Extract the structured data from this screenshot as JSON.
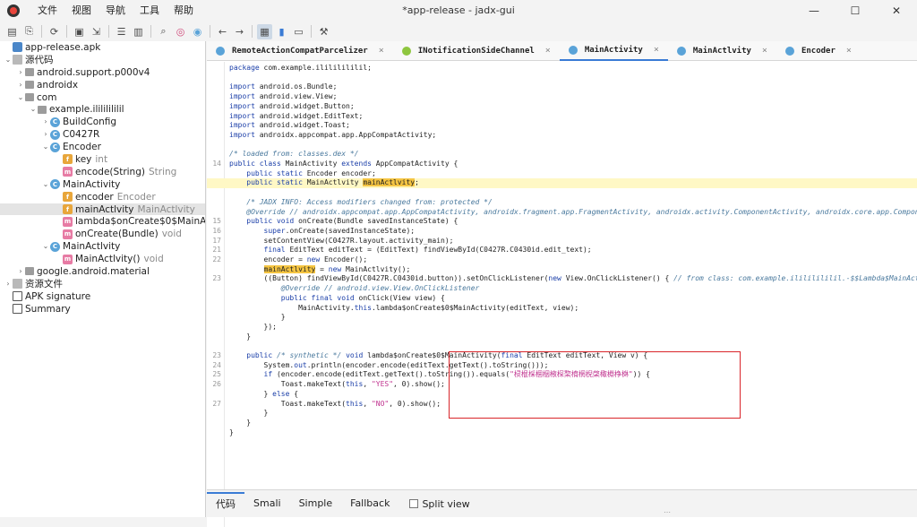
{
  "window": {
    "title": "*app-release - jadx-gui",
    "controls": [
      "—",
      "☐",
      "✕"
    ]
  },
  "menu": [
    "文件",
    "视图",
    "导航",
    "工具",
    "帮助"
  ],
  "toolbar": {
    "icons": [
      "open-icon",
      "save-all-icon",
      "sync-icon",
      "save-icon",
      "export-icon",
      "flatten-icon",
      "deobf-icon",
      "search-icon",
      "search-class-icon",
      "search-usage-icon",
      "back-icon",
      "forward-icon",
      "quark-icon",
      "log-icon",
      "settings-icon"
    ]
  },
  "tree": [
    {
      "label": "app-release.apk",
      "type": "",
      "indent": 0,
      "tw": "",
      "icon": "apk"
    },
    {
      "label": "源代码",
      "type": "",
      "indent": 0,
      "tw": "⌄",
      "icon": "src"
    },
    {
      "label": "android.support.p000v4",
      "type": "",
      "indent": 1,
      "tw": "›",
      "icon": "pkg"
    },
    {
      "label": "androidx",
      "type": "",
      "indent": 1,
      "tw": "›",
      "icon": "pkg"
    },
    {
      "label": "com",
      "type": "",
      "indent": 1,
      "tw": "⌄",
      "icon": "pkg"
    },
    {
      "label": "example.ilililililil",
      "type": "",
      "indent": 2,
      "tw": "⌄",
      "icon": "pkg"
    },
    {
      "label": "BuildConfig",
      "type": "",
      "indent": 3,
      "tw": "›",
      "icon": "c"
    },
    {
      "label": "C0427R",
      "type": "",
      "indent": 3,
      "tw": "›",
      "icon": "c"
    },
    {
      "label": "Encoder",
      "type": "",
      "indent": 3,
      "tw": "⌄",
      "icon": "c"
    },
    {
      "label": "key",
      "type": "int",
      "indent": 4,
      "tw": "",
      "icon": "f"
    },
    {
      "label": "encode(String)",
      "type": "String",
      "indent": 4,
      "tw": "",
      "icon": "m"
    },
    {
      "label": "MainActivity",
      "type": "",
      "indent": 3,
      "tw": "⌄",
      "icon": "c"
    },
    {
      "label": "encoder",
      "type": "Encoder",
      "indent": 4,
      "tw": "",
      "icon": "f"
    },
    {
      "label": "mainActlvity",
      "type": "MainActlvity",
      "indent": 4,
      "tw": "",
      "icon": "f",
      "selected": true
    },
    {
      "label": "lambda$onCreate$0$MainActi",
      "type": "",
      "indent": 4,
      "tw": "",
      "icon": "m"
    },
    {
      "label": "onCreate(Bundle)",
      "type": "void",
      "indent": 4,
      "tw": "",
      "icon": "m"
    },
    {
      "label": "MainActlvity",
      "type": "",
      "indent": 3,
      "tw": "⌄",
      "icon": "c"
    },
    {
      "label": "MainActlvity()",
      "type": "void",
      "indent": 4,
      "tw": "",
      "icon": "m"
    },
    {
      "label": "google.android.material",
      "type": "",
      "indent": 1,
      "tw": "›",
      "icon": "pkg"
    },
    {
      "label": "资源文件",
      "type": "",
      "indent": 0,
      "tw": "›",
      "icon": "src"
    },
    {
      "label": "APK signature",
      "type": "",
      "indent": 0,
      "tw": "",
      "icon": "doc"
    },
    {
      "label": "Summary",
      "type": "",
      "indent": 0,
      "tw": "",
      "icon": "doc"
    }
  ],
  "tabs": [
    {
      "label": "RemoteActionCompatParcelizer",
      "icon": "c",
      "active": false
    },
    {
      "label": "INotificationSideChannel",
      "icon": "i",
      "active": false
    },
    {
      "label": "MainActivity",
      "icon": "c",
      "active": true
    },
    {
      "label": "MainActlvity",
      "icon": "c",
      "active": false
    },
    {
      "label": "Encoder",
      "icon": "c",
      "active": false
    }
  ],
  "code": [
    {
      "ln": "",
      "html": "<span class=\"kw\">package</span> com.example.ilililililil;"
    },
    {
      "ln": "",
      "html": ""
    },
    {
      "ln": "",
      "html": "<span class=\"kw\">import</span> android.os.Bundle;"
    },
    {
      "ln": "",
      "html": "<span class=\"kw\">import</span> android.view.View;"
    },
    {
      "ln": "",
      "html": "<span class=\"kw\">import</span> android.widget.Button;"
    },
    {
      "ln": "",
      "html": "<span class=\"kw\">import</span> android.widget.EditText;"
    },
    {
      "ln": "",
      "html": "<span class=\"kw\">import</span> android.widget.Toast;"
    },
    {
      "ln": "",
      "html": "<span class=\"kw\">import</span> androidx.appcompat.app.AppCompatActivity;"
    },
    {
      "ln": "",
      "html": ""
    },
    {
      "ln": "",
      "html": "<span class=\"cm\">/* loaded from: classes.dex */</span>"
    },
    {
      "ln": "14",
      "html": "<span class=\"kw\">public class</span> MainActivity <span class=\"kw\">extends</span> AppCompatActivity {"
    },
    {
      "ln": "",
      "html": "    <span class=\"kw\">public static</span> Encoder encoder;"
    },
    {
      "ln": "",
      "html": "    <span class=\"kw\">public static</span> MainActlvity <span class=\"mark\">mainActlvity</span>;",
      "hl": true
    },
    {
      "ln": "",
      "html": ""
    },
    {
      "ln": "",
      "html": "    <span class=\"cm\">/* JADX INFO: Access modifiers changed from: protected */</span>"
    },
    {
      "ln": "",
      "html": "    <span class=\"cm\">@Override // androidx.appcompat.app.AppCompatActivity, androidx.fragment.app.FragmentActivity, androidx.activity.ComponentActivity, androidx.core.app.ComponentActivity</span>"
    },
    {
      "ln": "15",
      "html": "    <span class=\"kw\">public void</span> onCreate(Bundle savedInstanceState) {"
    },
    {
      "ln": "16",
      "html": "        <span class=\"kw\">super</span>.onCreate(savedInstanceState);"
    },
    {
      "ln": "17",
      "html": "        setContentView(C0427R.layout.activity_main);"
    },
    {
      "ln": "21",
      "html": "        <span class=\"kw\">final</span> EditText editText = (EditText) findViewById(C0427R.C0430id.edit_text);"
    },
    {
      "ln": "22",
      "html": "        encoder = <span class=\"kw\">new</span> Encoder();"
    },
    {
      "ln": "",
      "html": "        <span class=\"mark\">mainActlvity</span> = <span class=\"kw\">new</span> MainActlvity();"
    },
    {
      "ln": "23",
      "html": "        ((Button) findViewById(C0427R.C0430id.button)).setOnClickListener(<span class=\"kw\">new</span> View.OnClickListener() { <span class=\"cm\">// from class: com.example.ilililililil.-$$Lambda$MainActivity$</span>"
    },
    {
      "ln": "",
      "html": "            <span class=\"cm\">@Override // android.view.View.OnClickListener</span>"
    },
    {
      "ln": "",
      "html": "            <span class=\"kw\">public final void</span> onClick(View view) {"
    },
    {
      "ln": "",
      "html": "                MainActivity.<span class=\"kw\">this</span>.lambda$onCreate$0$MainActivity(editText, view);"
    },
    {
      "ln": "",
      "html": "            }"
    },
    {
      "ln": "",
      "html": "        });"
    },
    {
      "ln": "",
      "html": "    }"
    },
    {
      "ln": "",
      "html": ""
    },
    {
      "ln": "23",
      "html": "    <span class=\"kw\">public</span> <span class=\"cm\">/* synthetic */</span> <span class=\"kw\">void</span> lambda$onCreate$0$MainActivity(<span class=\"kw\">final</span> EditText editText, View v) {"
    },
    {
      "ln": "24",
      "html": "        System.<span class=\"kw\">out</span>.println(encoder.encode(editText.getText().toString()));"
    },
    {
      "ln": "25",
      "html": "        <span class=\"kw\">if</span> (encoder.encode(editText.getText().toString()).equals(<span class=\"str\">\"棂棍棌棝栶棭棎棃棛棢棿棨棷棩棦棥\"</span>)) {"
    },
    {
      "ln": "26",
      "html": "            Toast.makeText(<span class=\"kw\">this</span>, <span class=\"str\">\"YES\"</span>, 0).show();"
    },
    {
      "ln": "",
      "html": "        } <span class=\"kw\">else</span> {"
    },
    {
      "ln": "27",
      "html": "            Toast.makeText(<span class=\"kw\">this</span>, <span class=\"str\">\"NO\"</span>, 0).show();"
    },
    {
      "ln": "",
      "html": "        }"
    },
    {
      "ln": "",
      "html": "    }"
    },
    {
      "ln": "",
      "html": "}"
    }
  ],
  "bottom_tabs": [
    {
      "label": "代码",
      "active": true
    },
    {
      "label": "Smali",
      "active": false
    },
    {
      "label": "Simple",
      "active": false
    },
    {
      "label": "Fallback",
      "active": false
    }
  ],
  "split_view": {
    "label": "Split view",
    "checked": false
  }
}
